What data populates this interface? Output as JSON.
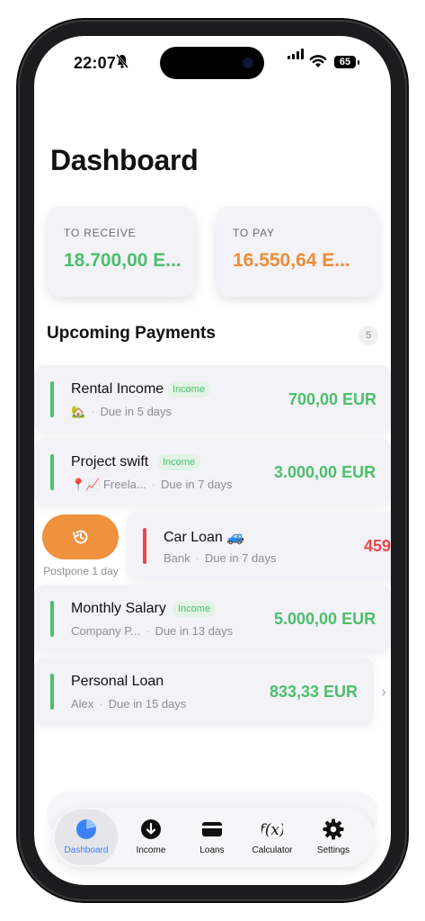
{
  "status_bar": {
    "time": "22:07",
    "battery": "65"
  },
  "header": {
    "title": "Dashboard"
  },
  "summary": {
    "receive": {
      "label": "TO RECEIVE",
      "value": "18.700,00 E...",
      "color": "#4cbf6b"
    },
    "pay": {
      "label": "TO PAY",
      "value": "16.550,64 E...",
      "color": "#ef8c35"
    }
  },
  "upcoming": {
    "title": "Upcoming Payments",
    "count": "5",
    "items": [
      {
        "name": "Rental Income",
        "badge": "Income",
        "source": "🏡",
        "due": "Due in 5 days",
        "amount": "700,00 EUR",
        "type": "income"
      },
      {
        "name": "Project swift",
        "badge": "Income",
        "source": "📍📈 Freela...",
        "due": "Due in 7 days",
        "amount": "3.000,00 EUR",
        "type": "income"
      },
      {
        "name": "Car Loan 🚙",
        "badge": "",
        "source": "Bank",
        "due": "Due in 7 days",
        "amount": "459",
        "type": "loan"
      },
      {
        "name": "Monthly Salary",
        "badge": "Income",
        "source": "Company P...",
        "due": "Due in 13 days",
        "amount": "5.000,00 EUR",
        "type": "income"
      },
      {
        "name": "Personal Loan",
        "badge": "",
        "source": "Alex",
        "due": "Due in 15 days",
        "amount": "833,33 EUR",
        "type": "income"
      }
    ],
    "postpone_label": "Postpone 1 day"
  },
  "colors": {
    "income": "#4cbf6b",
    "loan": "#e5484d",
    "accent": "#3b82f6",
    "postpone": "#f0913d"
  },
  "tabbar": {
    "tabs": [
      {
        "label": "Dashboard",
        "icon": "pie-chart-icon",
        "active": true
      },
      {
        "label": "Income",
        "icon": "arrow-down-circle-icon",
        "active": false
      },
      {
        "label": "Loans",
        "icon": "credit-card-icon",
        "active": false
      },
      {
        "label": "Calculator",
        "icon": "function-icon",
        "active": false
      },
      {
        "label": "Settings",
        "icon": "gear-icon",
        "active": false
      }
    ]
  }
}
